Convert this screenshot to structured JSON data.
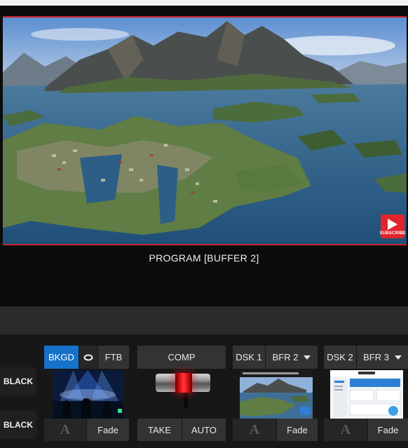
{
  "program": {
    "label": "PROGRAM [BUFFER 2]",
    "badge_text": "SUBSCRIBE",
    "badge_icon": "youtube-play-icon"
  },
  "transition": {
    "row1": [
      "BKGD",
      "FTB"
    ],
    "bkgd_active": true,
    "comp_label": "COMP",
    "take_label": "TAKE",
    "auto_label": "AUTO"
  },
  "side_buttons": [
    "BLACK",
    "BLACK"
  ],
  "dsk1": {
    "label": "DSK 1",
    "source": "BFR 2",
    "fade": "Fade"
  },
  "dsk2": {
    "label": "DSK 2",
    "source": "BFR 3",
    "fade": "Fade"
  },
  "bkgd_fade": "Fade",
  "colors": {
    "accent_blue": "#1671c9",
    "tally_red": "#c8242d",
    "tbar_red": "#e3141c"
  },
  "icons": [
    "link-icon",
    "dropdown-arrow-icon",
    "auto-mode-a-icon"
  ]
}
